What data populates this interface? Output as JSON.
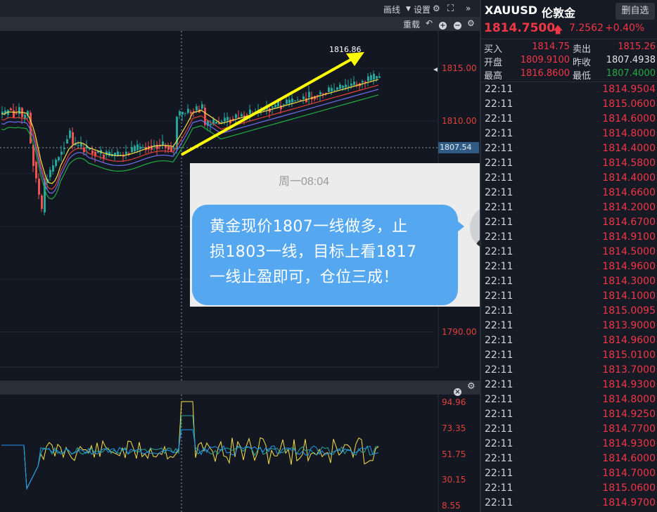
{
  "toolbar": {
    "draw_label": "画线",
    "settings_label": "设置",
    "reset_label": "重载"
  },
  "chart_data": {
    "type": "candlestick",
    "annotation_high": "1816.86",
    "current_price_tag": "1807.54",
    "price_axis_ticks": [
      "1815.00",
      "1810.00",
      "1790.00"
    ],
    "price_axis_tick_values": [
      1815.0,
      1810.0,
      1790.0
    ],
    "colors": {
      "up": "#26a69a",
      "down": "#ef5350",
      "ma1": "#f7e04a",
      "ma2": "#e0413b",
      "ma3": "#6d6ff0",
      "ma4": "#22ab3e",
      "arrow": "#ffff00"
    },
    "indicator": {
      "ticks": [
        "94.96",
        "73.35",
        "51.75",
        "30.15",
        "8.55"
      ],
      "tick_values": [
        94.96,
        73.35,
        51.75,
        30.15,
        8.55
      ],
      "colors": [
        "#f7e04a",
        "#26a69a",
        "#2196f3"
      ]
    }
  },
  "chat": {
    "timestamp": "周一08:04",
    "lines": [
      "黄金现价1807一线做多，止",
      "损1803一线，目标上看1817",
      "一线止盈即可，仓位三成！"
    ]
  },
  "quote": {
    "symbol": "XAUUSD",
    "name": "伦敦金",
    "remove_button": "删自选",
    "last": "1814.7500",
    "change": "7.2562",
    "change_pct": "+0.40%",
    "fields": [
      {
        "label": "买入",
        "value": "1814.75",
        "label2": "卖出",
        "value2": "1815.26",
        "c1": "red",
        "c2": "red"
      },
      {
        "label": "开盘",
        "value": "1809.9100",
        "label2": "昨收",
        "value2": "1807.4938",
        "c1": "red",
        "c2": "wht"
      },
      {
        "label": "最高",
        "value": "1816.8600",
        "label2": "最低",
        "value2": "1807.4000",
        "c1": "red",
        "c2": "grn"
      }
    ]
  },
  "ticks": [
    {
      "time": "22:11",
      "price": "1814.9504"
    },
    {
      "time": "22:11",
      "price": "1815.0600"
    },
    {
      "time": "22:11",
      "price": "1814.6000"
    },
    {
      "time": "22:11",
      "price": "1814.8000"
    },
    {
      "time": "22:11",
      "price": "1814.4000"
    },
    {
      "time": "22:11",
      "price": "1814.5800"
    },
    {
      "time": "22:11",
      "price": "1814.4000"
    },
    {
      "time": "22:11",
      "price": "1814.6600"
    },
    {
      "time": "22:11",
      "price": "1814.2000"
    },
    {
      "time": "22:11",
      "price": "1814.6700"
    },
    {
      "time": "22:11",
      "price": "1814.9100"
    },
    {
      "time": "22:11",
      "price": "1814.5000"
    },
    {
      "time": "22:11",
      "price": "1814.9600"
    },
    {
      "time": "22:11",
      "price": "1814.3000"
    },
    {
      "time": "22:11",
      "price": "1814.1000"
    },
    {
      "time": "22:11",
      "price": "1815.0095"
    },
    {
      "time": "22:11",
      "price": "1813.9000"
    },
    {
      "time": "22:11",
      "price": "1814.9600"
    },
    {
      "time": "22:11",
      "price": "1815.0100"
    },
    {
      "time": "22:11",
      "price": "1813.7000"
    },
    {
      "time": "22:11",
      "price": "1814.9300"
    },
    {
      "time": "22:11",
      "price": "1814.8000"
    },
    {
      "time": "22:11",
      "price": "1814.9250"
    },
    {
      "time": "22:11",
      "price": "1814.7700"
    },
    {
      "time": "22:11",
      "price": "1814.9300"
    },
    {
      "time": "22:11",
      "price": "1814.6000"
    },
    {
      "time": "22:11",
      "price": "1814.7000"
    },
    {
      "time": "22:11",
      "price": "1815.0600"
    },
    {
      "time": "22:11",
      "price": "1814.9700"
    }
  ]
}
